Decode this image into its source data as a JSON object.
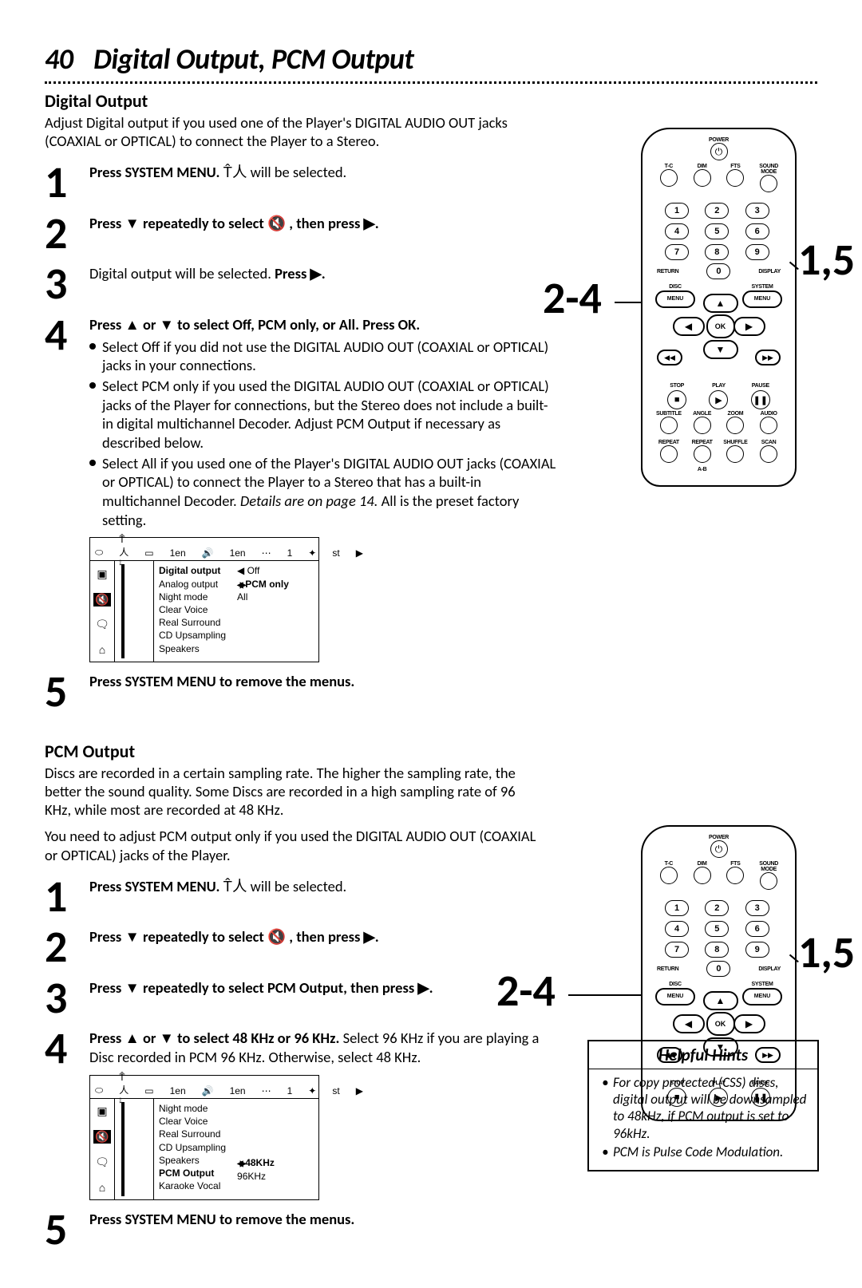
{
  "page_number": "40",
  "page_title": "Digital Output, PCM Output",
  "section_a": {
    "heading": "Digital Output",
    "intro": "Adjust Digital output if you used one of the Player's DIGITAL AUDIO OUT jacks (COAXIAL or OPTICAL) to connect the Player to a Stereo.",
    "steps": {
      "1": {
        "bold": "Press SYSTEM MENU.",
        "plain": " will be selected."
      },
      "2": {
        "bold_a": "Press ▼ repeatedly to select ",
        "bold_b": " , then press ▶."
      },
      "3": {
        "plain_a": "Digital output will be selected. ",
        "bold": "Press ▶."
      },
      "4": {
        "bold": "Press ▲ or ▼ to select Off, PCM only, or All. Press OK.",
        "b1": "Select Off if you did not use the DIGITAL AUDIO OUT (COAXIAL or OPTICAL) jacks in your connections.",
        "b2": "Select PCM only if you used the DIGITAL AUDIO OUT (COAXIAL or OPTICAL) jacks of the Player for connections, but the Stereo does not include a built-in digital multichannel Decoder. Adjust PCM Output if necessary as described below.",
        "b3a": "Select All if you used one of the Player's DIGITAL AUDIO OUT jacks (COAXIAL or OPTICAL) to connect the Player to a Stereo that has a built-in multichannel Decoder. ",
        "b3i": "Details are on page 14.",
        "b3b": " All is the preset factory setting."
      },
      "5": {
        "bold": "Press SYSTEM MENU to remove the menus."
      }
    },
    "osd": {
      "top": [
        "1en",
        "1en",
        "1",
        "st"
      ],
      "items": [
        "Digital output",
        "Analog output",
        "Night mode",
        "Clear Voice",
        "Real Surround",
        "CD Upsampling",
        "Speakers"
      ],
      "options": [
        "Off",
        "PCM only",
        "All"
      ]
    }
  },
  "section_b": {
    "heading": "PCM Output",
    "intro1": "Discs are recorded in a certain sampling rate. The higher the sampling rate, the better the sound quality. Some Discs are recorded in a high sampling rate of 96 KHz, while most are recorded at 48 KHz.",
    "intro2": "You need to adjust PCM output only if you used the DIGITAL AUDIO OUT (COAXIAL or OPTICAL) jacks of the Player.",
    "steps": {
      "1": {
        "bold": "Press SYSTEM MENU.",
        "plain": " will be selected."
      },
      "2": {
        "bold_a": "Press ▼ repeatedly to select ",
        "bold_b": " , then press ▶."
      },
      "3": {
        "bold": "Press ▼ repeatedly to select PCM Output, then press ▶."
      },
      "4": {
        "bold": "Press ▲ or ▼ to select 48 KHz or 96 KHz.",
        "plain": " Select 96 KHz if you are playing a Disc recorded in PCM 96 KHz. Otherwise, select 48 KHz."
      },
      "5": {
        "bold": "Press SYSTEM MENU to remove the menus."
      }
    },
    "osd": {
      "top": [
        "1en",
        "1en",
        "1",
        "st"
      ],
      "items": [
        "Night mode",
        "Clear Voice",
        "Real Surround",
        "CD Upsampling",
        "Speakers",
        "PCM Output",
        "Karaoke Vocal"
      ],
      "options": [
        "48KHz",
        "96KHz"
      ]
    }
  },
  "hints": {
    "title": "Helpful Hints",
    "h1": "For copy protected (CSS) discs, digital output will be downsampled to 48kHz, if PCM output is set to 96kHz.",
    "h2": "PCM is Pulse Code Modulation."
  },
  "remote": {
    "power": "POWER",
    "row1": [
      "T-C",
      "DIM",
      "FTS",
      "SOUND MODE"
    ],
    "nums": [
      "1",
      "2",
      "3",
      "4",
      "5",
      "6",
      "7",
      "8",
      "9",
      "0"
    ],
    "return": "RETURN",
    "display": "DISPLAY",
    "disc_menu": "DISC",
    "system_menu": "SYSTEM",
    "menu_label": "MENU",
    "ok": "OK",
    "stop": "STOP",
    "play": "PLAY",
    "pause": "PAUSE",
    "row_bot1": [
      "SUBTITLE",
      "ANGLE",
      "ZOOM",
      "AUDIO"
    ],
    "row_bot2": [
      "REPEAT",
      "REPEAT",
      "SHUFFLE",
      "SCAN"
    ],
    "ab": "A-B"
  },
  "callouts": {
    "left": "2-4",
    "right": "1,5"
  }
}
